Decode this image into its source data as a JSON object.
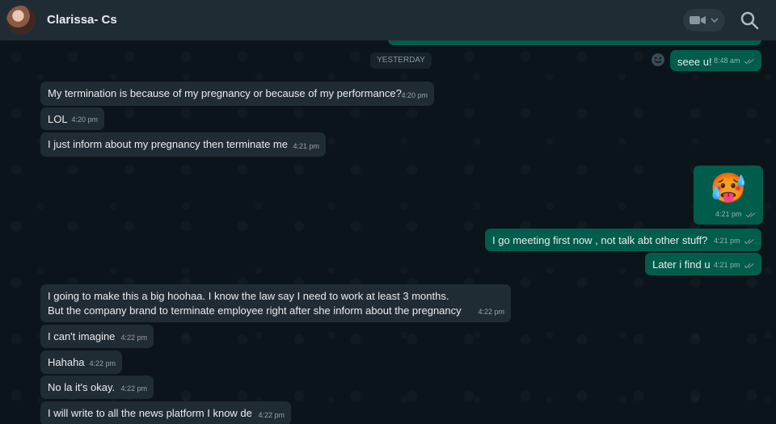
{
  "header": {
    "contact_name": "Clarissa- Cs",
    "icons": {
      "video": "video-camera-icon",
      "chevron": "chevron-down-icon",
      "search": "search-icon"
    }
  },
  "colors": {
    "background": "#0b141a",
    "header": "#202c33",
    "incoming_bubble": "#202c33",
    "outgoing_bubble": "#005c4b",
    "meta_text": "#8696a0"
  },
  "chat": {
    "date_divider": "YESTERDAY",
    "top_outgoing": {
      "text": "seee u!",
      "time": "8:48 am"
    },
    "messages": [
      {
        "direction": "in",
        "text": "My termination is because of my pregnancy or because of my performance?",
        "time": "4:20 pm"
      },
      {
        "direction": "in",
        "text": "LOL",
        "time": "4:20 pm"
      },
      {
        "direction": "in",
        "text": "I just inform about my pregnancy then terminate me",
        "time": "4:21 pm"
      },
      {
        "direction": "out",
        "text": "🥵",
        "time": "4:21 pm"
      },
      {
        "direction": "out",
        "text": "I go meeting first now , not talk abt other stuff?",
        "time": "4:21 pm"
      },
      {
        "direction": "out",
        "text": "Later i find u",
        "time": "4:21 pm"
      },
      {
        "direction": "in",
        "text": "I going to make this a big hoohaa. I know the law say I need to work at least 3 months. But the company brand to terminate employee right after she inform about the pregnancy",
        "time": "4:22 pm"
      },
      {
        "direction": "in",
        "text": "I can't imagine",
        "time": "4:22 pm"
      },
      {
        "direction": "in",
        "text": "Hahaha",
        "time": "4:22 pm"
      },
      {
        "direction": "in",
        "text": "No la it's okay.",
        "time": "4:22 pm"
      },
      {
        "direction": "in",
        "text": "I will write to all the news platform I know de",
        "time": "4:22 pm"
      }
    ]
  }
}
